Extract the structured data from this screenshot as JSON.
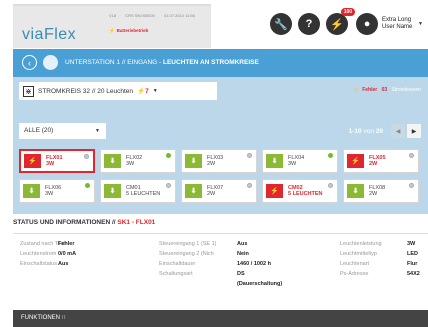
{
  "header": {
    "logo": "viaFlex",
    "version": "V18",
    "device": "CRS SN:000000",
    "datetime": "01.07.2014 11:56",
    "battery": "Batteriebetrieb",
    "notification_count": "100",
    "user_name": "Extra Long User Name"
  },
  "breadcrumb": {
    "path": "UNTERSTATION 1 // EINGANG -",
    "current": "LEUCHTEN AN STROMKREISE"
  },
  "circuit": {
    "label": "STROMKREIS 32 // 20 Leuchten",
    "error_count": "7",
    "status_prefix": "Fehler",
    "status_count": "03",
    "status_suffix": "Stromkreisen"
  },
  "filter": {
    "selected": "ALLE (20)",
    "range": "1-10",
    "von": "von",
    "total": "20"
  },
  "tiles": [
    {
      "name": "FLX01",
      "sub": "3W",
      "state": "error",
      "dot": "grey"
    },
    {
      "name": "FLX02",
      "sub": "3W",
      "state": "ok",
      "dot": "green"
    },
    {
      "name": "FLX03",
      "sub": "2W",
      "state": "ok",
      "dot": "grey"
    },
    {
      "name": "FLX04",
      "sub": "3W",
      "state": "ok",
      "dot": "green"
    },
    {
      "name": "FLX05",
      "sub": "2W",
      "state": "error-noborder",
      "dot": "grey"
    },
    {
      "name": "FLX06",
      "sub": "3W",
      "state": "ok",
      "dot": "green"
    },
    {
      "name": "CM01",
      "sub": "5 Leuchten",
      "state": "ok",
      "dot": "grey"
    },
    {
      "name": "FLX07",
      "sub": "2W",
      "state": "ok",
      "dot": "grey"
    },
    {
      "name": "CM02",
      "sub": "5 Leuchten",
      "state": "error-noborder",
      "dot": "grey"
    },
    {
      "name": "FLX08",
      "sub": "2W",
      "state": "ok",
      "dot": "grey"
    }
  ],
  "status": {
    "title": "STATUS UND INFORMATIONEN //",
    "title_highlight": "SK1 - FLX01",
    "col1": [
      {
        "k": "Zustand nach Test",
        "v": "Fehler"
      },
      {
        "k": "Leuchtenstrom",
        "v": "0/0 mA"
      },
      {
        "k": "Einschaltstatus",
        "v": "Aus"
      }
    ],
    "col2": [
      {
        "k": "Steuereingang 1 (SE 1)",
        "v": "Aus"
      },
      {
        "k": "Steuereingang 2 (Nich",
        "v": "Nein"
      },
      {
        "k": "Einschaltdauer",
        "v": "1460 / 1002 h"
      },
      {
        "k": "Schaltungsart",
        "v": "DS"
      },
      {
        "k": "",
        "v": "(Dauerschaltung)"
      }
    ],
    "col3": [
      {
        "k": "Leuchtenleistung",
        "v": "3W"
      },
      {
        "k": "Leuchtmitteltyp",
        "v": "LED"
      },
      {
        "k": "Leuchtenart",
        "v": "Flur"
      },
      {
        "k": "Ps-Adresse",
        "v": "54X2"
      }
    ]
  },
  "footer": {
    "label": "FUNKTIONEN"
  }
}
